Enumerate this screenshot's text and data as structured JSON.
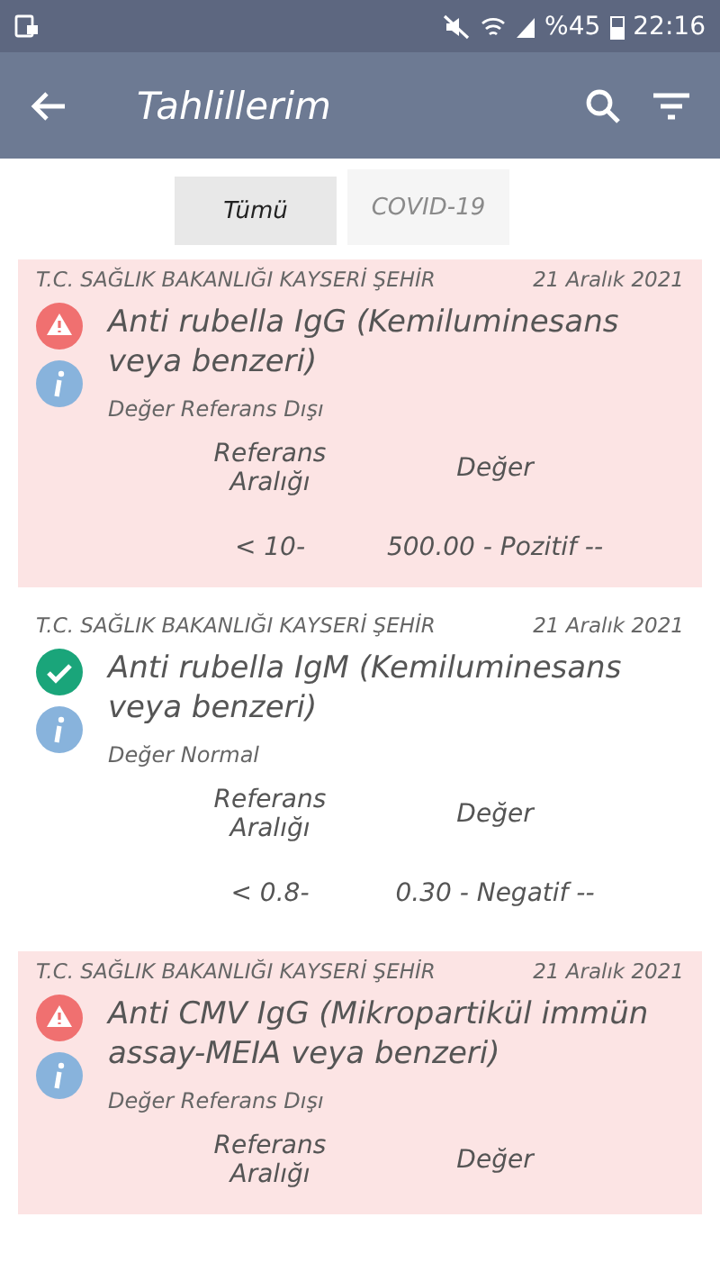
{
  "status_bar": {
    "battery": "%45",
    "time": "22:16"
  },
  "app_bar": {
    "title": "Tahlillerim"
  },
  "tabs": [
    {
      "label": "Tümü",
      "selected": true
    },
    {
      "label": "COVID-19",
      "selected": false
    }
  ],
  "results": [
    {
      "source": "T.C. SAĞLIK BAKANLIĞI KAYSERİ ŞEHİR",
      "date": "21 Aralık 2021",
      "kind": "abnormal",
      "name": "Anti rubella IgG (Kemiluminesans veya benzeri)",
      "status_text": "Değer Referans Dışı",
      "range_header": "Referans Aralığı",
      "value_header": "Değer",
      "range": "< 10-",
      "value": "500.00 - Pozitif --"
    },
    {
      "source": "T.C. SAĞLIK BAKANLIĞI KAYSERİ ŞEHİR",
      "date": "21 Aralık 2021",
      "kind": "normal",
      "name": "Anti rubella IgM (Kemiluminesans veya benzeri)",
      "status_text": "Değer Normal",
      "range_header": "Referans Aralığı",
      "value_header": "Değer",
      "range": "< 0.8-",
      "value": "0.30 - Negatif --"
    },
    {
      "source": "T.C. SAĞLIK BAKANLIĞI KAYSERİ ŞEHİR",
      "date": "21 Aralık 2021",
      "kind": "abnormal",
      "name": "Anti CMV IgG (Mikropartikül immün assay-MEIA veya benzeri)",
      "status_text": "Değer Referans Dışı",
      "range_header": "Referans Aralığı",
      "value_header": "Değer"
    }
  ]
}
